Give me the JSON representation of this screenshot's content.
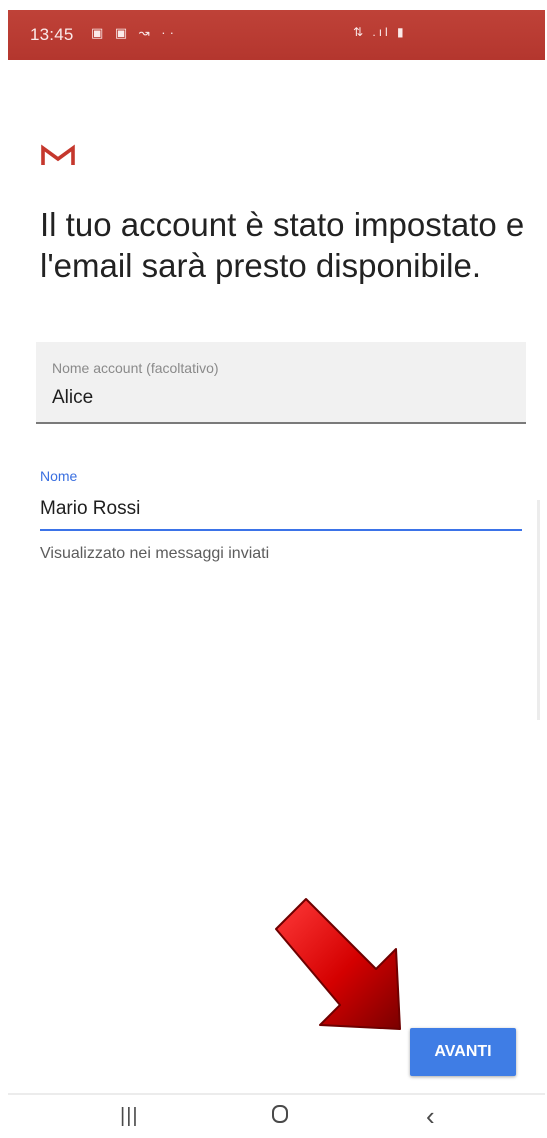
{
  "status_bar": {
    "time": "13:45",
    "left_icons": "▣ ▣ ↝ ··",
    "right_icons": "⇅ .ıl ▮",
    "color": "#b83a32"
  },
  "app": {
    "logo_icon": "gmail-m-icon",
    "headline": "Il tuo account è stato impostato e l'email sarà presto disponibile."
  },
  "account_field": {
    "label": "Nome account (facoltativo)",
    "value": "Alice"
  },
  "name_field": {
    "label": "Nome",
    "value": "Mario Rossi",
    "helper": "Visualizzato nei messaggi inviati",
    "accent": "#3b73e8"
  },
  "next_button": {
    "label": "AVANTI",
    "color": "#3f7de5"
  },
  "annotation": {
    "icon": "red-arrow-icon",
    "color": "#c40000"
  },
  "nav_bar": {
    "recents_icon": "recents-icon",
    "home_icon": "home-icon",
    "back_icon": "back-icon"
  }
}
